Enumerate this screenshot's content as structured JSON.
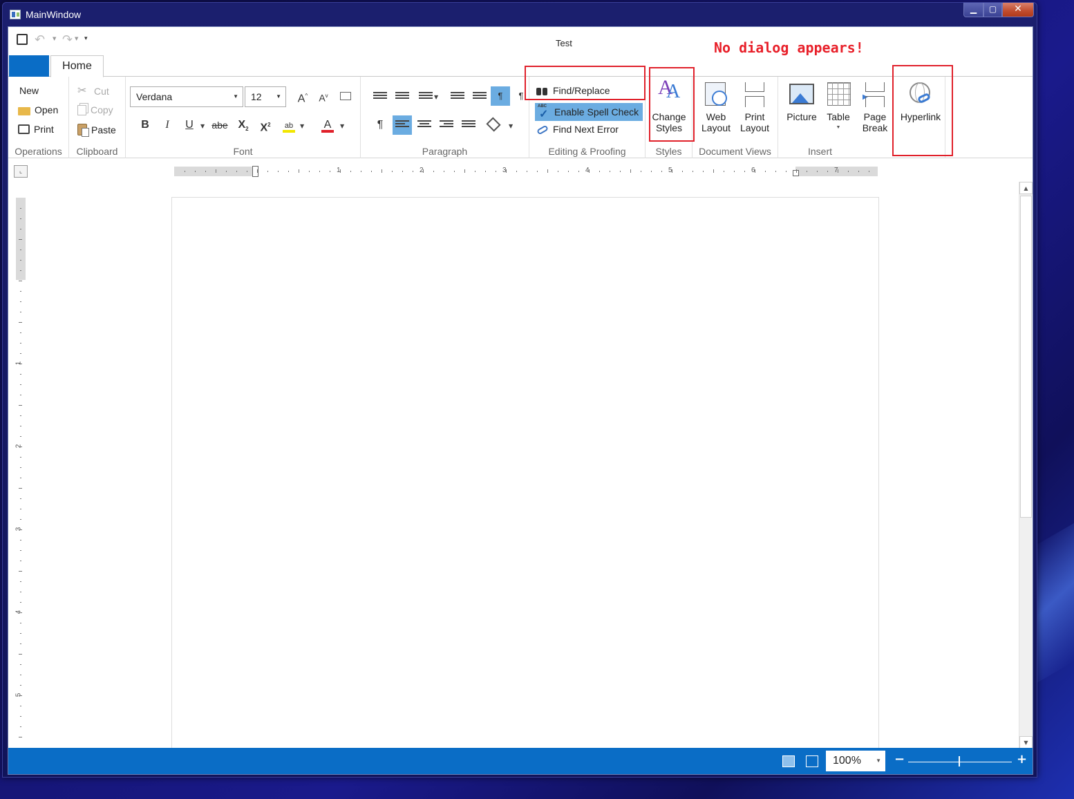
{
  "window": {
    "title": "MainWindow",
    "document_title": "Test",
    "annotation": "No dialog appears!"
  },
  "tabs": {
    "home": "Home"
  },
  "groups": {
    "operations": {
      "label": "Operations",
      "new": "New",
      "open": "Open",
      "print": "Print"
    },
    "clipboard": {
      "label": "Clipboard",
      "cut": "Cut",
      "copy": "Copy",
      "paste": "Paste"
    },
    "font": {
      "label": "Font",
      "family": "Verdana",
      "size": "12",
      "bold": "B",
      "italic": "I",
      "underline": "U",
      "strike": "abe",
      "sub": "X",
      "sup": "X",
      "grow": "A",
      "shrink": "A"
    },
    "paragraph": {
      "label": "Paragraph",
      "pilcrow": "¶"
    },
    "editing": {
      "label": "Editing & Proofing",
      "find_replace": "Find/Replace",
      "spell_check": "Enable Spell Check",
      "find_next_error": "Find Next Error"
    },
    "styles": {
      "label": "Styles",
      "change_line1": "Change",
      "change_line2": "Styles"
    },
    "views": {
      "label": "Document Views",
      "web_line1": "Web",
      "web_line2": "Layout",
      "print_line1": "Print",
      "print_line2": "Layout"
    },
    "insert": {
      "label": "Insert",
      "picture": "Picture",
      "table": "Table",
      "page_line1": "Page",
      "page_line2": "Break",
      "hyperlink": "Hyperlink"
    }
  },
  "ruler": {
    "horizontal_numbers": [
      "1",
      "2",
      "3",
      "4",
      "5",
      "6",
      "7"
    ],
    "vertical_numbers": [
      "1",
      "2",
      "3",
      "4",
      "5"
    ]
  },
  "status": {
    "zoom": "100%",
    "minus": "−",
    "plus": "+"
  },
  "colors": {
    "accent": "#0a6dc6",
    "annotation": "#e8202a",
    "highlight": "#6bace1"
  }
}
